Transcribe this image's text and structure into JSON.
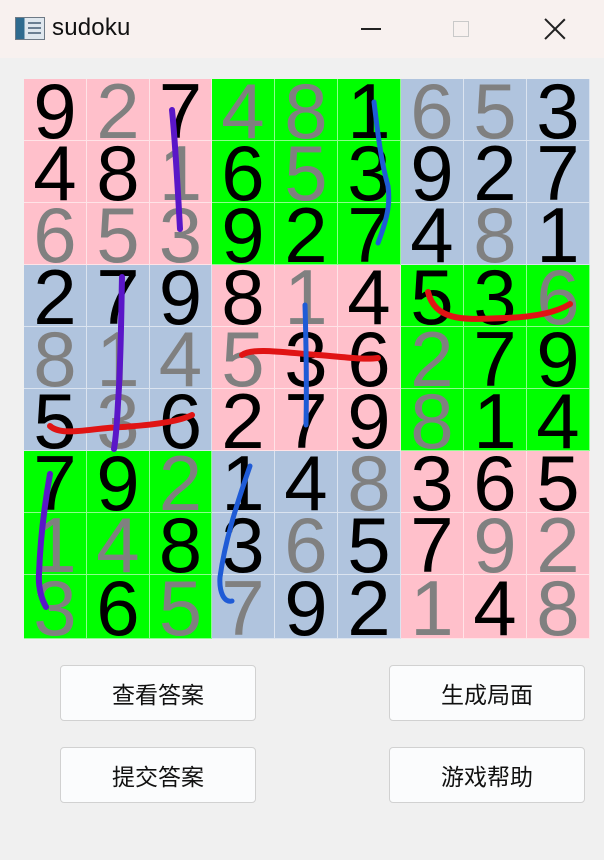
{
  "window": {
    "title": "sudoku",
    "icon": "app-icon",
    "controls": [
      "minimize-icon",
      "maximize-icon",
      "close-icon"
    ]
  },
  "colors": {
    "pink": "#ffc0cb",
    "green": "#00ff00",
    "blue": "#b0c4de",
    "given": "#000000",
    "filled": "#808080",
    "red_stroke": "#e01414",
    "blue_stroke": "#1f5bd6",
    "purple_stroke": "#5a16c8"
  },
  "board": {
    "rows": [
      [
        "9",
        "2",
        "7",
        "4",
        "8",
        "1",
        "6",
        "5",
        "3"
      ],
      [
        "4",
        "8",
        "1",
        "6",
        "5",
        "3",
        "9",
        "2",
        "7"
      ],
      [
        "6",
        "5",
        "3",
        "9",
        "2",
        "7",
        "4",
        "8",
        "1"
      ],
      [
        "2",
        "7",
        "9",
        "8",
        "1",
        "4",
        "5",
        "3",
        "6"
      ],
      [
        "8",
        "1",
        "4",
        "5",
        "3",
        "6",
        "2",
        "7",
        "9"
      ],
      [
        "5",
        "3",
        "6",
        "2",
        "7",
        "9",
        "8",
        "1",
        "4"
      ],
      [
        "7",
        "9",
        "2",
        "1",
        "4",
        "8",
        "3",
        "6",
        "5"
      ],
      [
        "1",
        "4",
        "8",
        "3",
        "6",
        "5",
        "7",
        "9",
        "2"
      ],
      [
        "3",
        "6",
        "5",
        "7",
        "9",
        "2",
        "1",
        "4",
        "8"
      ]
    ],
    "given": [
      [
        1,
        0,
        1,
        0,
        0,
        1,
        0,
        0,
        1
      ],
      [
        1,
        1,
        0,
        1,
        0,
        1,
        1,
        1,
        1
      ],
      [
        0,
        0,
        0,
        1,
        1,
        1,
        1,
        0,
        1
      ],
      [
        1,
        1,
        1,
        1,
        0,
        1,
        1,
        1,
        0
      ],
      [
        0,
        0,
        0,
        0,
        1,
        1,
        0,
        1,
        1
      ],
      [
        1,
        0,
        1,
        1,
        1,
        1,
        0,
        1,
        1
      ],
      [
        1,
        1,
        0,
        1,
        1,
        0,
        1,
        1,
        1
      ],
      [
        0,
        0,
        1,
        1,
        0,
        1,
        1,
        0,
        0
      ],
      [
        0,
        1,
        0,
        0,
        1,
        1,
        0,
        1,
        0
      ]
    ],
    "box_colors": [
      [
        "pink",
        "green",
        "blue"
      ],
      [
        "blue",
        "pink",
        "green"
      ],
      [
        "green",
        "blue",
        "pink"
      ]
    ]
  },
  "buttons": {
    "view_answer": "查看答案",
    "generate_board": "生成局面",
    "submit_answer": "提交答案",
    "game_help": "游戏帮助"
  }
}
